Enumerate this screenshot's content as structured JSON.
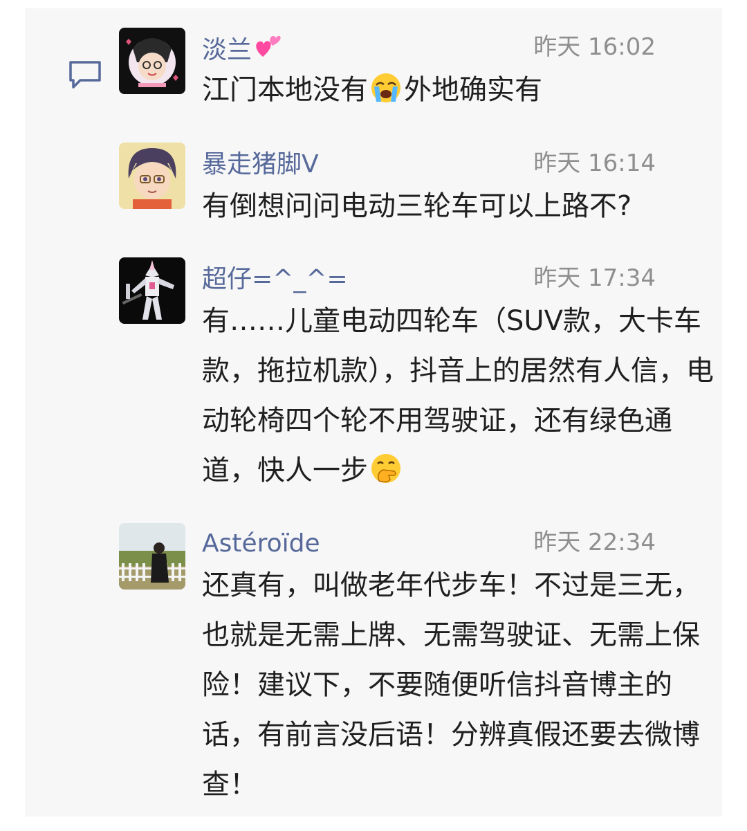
{
  "comments": [
    {
      "author": "淡兰",
      "time": "昨天 16:02",
      "text_before_emoji": "江门本地没有",
      "emoji": "loudly-crying-face-icon",
      "text_after_emoji": "外地确实有"
    },
    {
      "author": "暴走猪脚V",
      "time": "昨天 16:14",
      "text": "有倒想问问电动三轮车可以上路不?"
    },
    {
      "author": "超仔=^_^=",
      "time": "昨天 17:34",
      "text": "有……儿童电动四轮车（SUV款，大卡车款，拖拉机款），抖音上的居然有人信，电动轮椅四个轮不用驾驶证，还有绿色通道，快人一步",
      "emoji": "face-with-hand-over-mouth-icon"
    },
    {
      "author": "Astéroïde",
      "time": "昨天 22:34",
      "text": "还真有，叫做老年代步车！不过是三无，也就是无需上牌、无需驾驶证、无需上保险！建议下，不要随便听信抖音博主的话，有前言没后语！分辨真假还要去微博查！"
    }
  ],
  "colors": {
    "author": "#56699a",
    "time": "#8f8f8f",
    "text": "#1f1f1f",
    "background": "#f7f7f7"
  }
}
